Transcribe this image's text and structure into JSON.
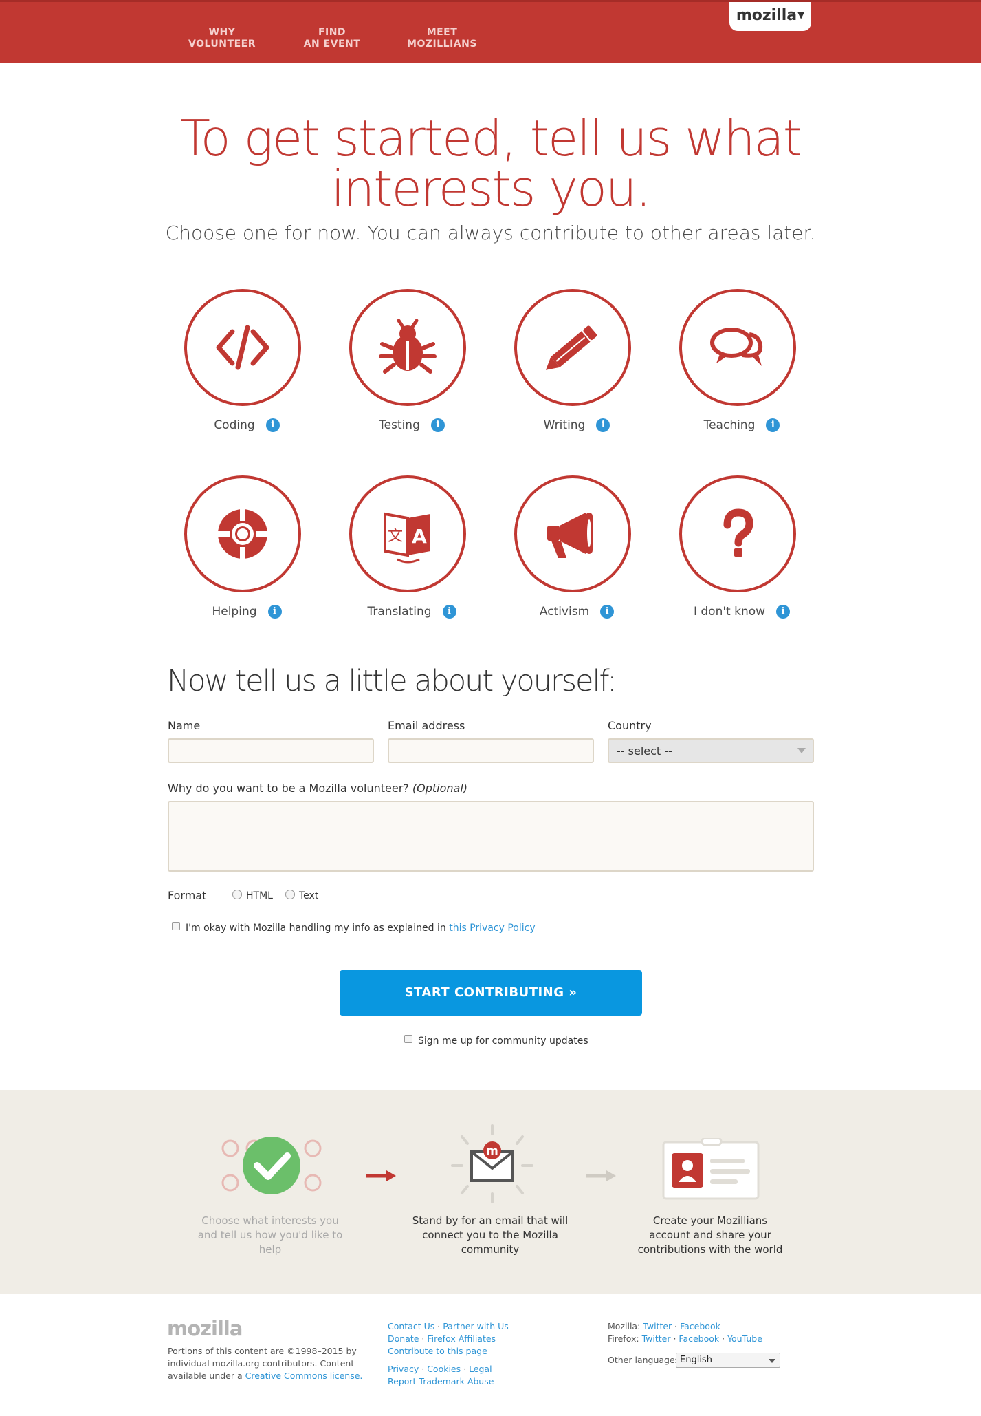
{
  "header": {
    "nav": [
      {
        "line1": "WHY",
        "line2": "VOLUNTEER"
      },
      {
        "line1": "FIND",
        "line2": "AN EVENT"
      },
      {
        "line1": "MEET",
        "line2": "MOZILLIANS"
      }
    ],
    "tab_label": "mozilla",
    "tab_icon": "chevron-down-icon"
  },
  "hero": {
    "title_line1": "To get started, tell us what",
    "title_line2": "interests you.",
    "subtitle": "Choose one for now. You can always contribute to other areas later."
  },
  "interests": [
    {
      "label": "Coding",
      "icon": "code-icon"
    },
    {
      "label": "Testing",
      "icon": "bug-icon"
    },
    {
      "label": "Writing",
      "icon": "pencil-icon"
    },
    {
      "label": "Teaching",
      "icon": "chat-bubbles-icon"
    },
    {
      "label": "Helping",
      "icon": "lifebuoy-icon"
    },
    {
      "label": "Translating",
      "icon": "translate-icon"
    },
    {
      "label": "Activism",
      "icon": "megaphone-icon"
    },
    {
      "label": "I don't know",
      "icon": "question-mark-icon"
    }
  ],
  "info_glyph": "i",
  "form": {
    "section_title": "Now tell us a little about yourself:",
    "name_label": "Name",
    "email_label": "Email address",
    "country_label": "Country",
    "country_value": "-- select --",
    "why_label": "Why do you want to be a Mozilla volunteer?",
    "why_optional": "(Optional)",
    "format_label": "Format",
    "format_html": "HTML",
    "format_text": "Text",
    "privacy_text": "I'm okay with Mozilla handling my info as explained in",
    "privacy_link": "this Privacy Policy",
    "submit": "START CONTRIBUTING »",
    "updates_label": "Sign me up for community updates"
  },
  "steps": [
    {
      "text": "Choose what interests you and tell us how you'd like to help",
      "icon": "checkmark-icon"
    },
    {
      "text": "Stand by for an email that will connect you to the Mozilla community",
      "icon": "mail-icon"
    },
    {
      "text": "Create your Mozillians account and share your contributions with the world",
      "icon": "id-card-icon"
    }
  ],
  "footer": {
    "logo": "mozilla",
    "copyright": "Portions of this content are ©1998–2015 by individual mozilla.org contributors. Content available under a",
    "cc_link": "Creative Commons license.",
    "links_col2": {
      "contact": "Contact Us",
      "partner": "Partner with Us",
      "donate": "Donate",
      "affiliates": "Firefox Affiliates",
      "contribute": "Contribute to this page",
      "privacy": "Privacy",
      "cookies": "Cookies",
      "legal": "Legal",
      "trademark": "Report Trademark Abuse"
    },
    "social": {
      "mozilla_label": "Mozilla:",
      "mozilla_twitter": "Twitter",
      "mozilla_facebook": "Facebook",
      "firefox_label": "Firefox:",
      "firefox_twitter": "Twitter",
      "firefox_facebook": "Facebook",
      "firefox_youtube": "YouTube"
    },
    "other_languages_label": "Other languages:",
    "language_value": "English"
  },
  "colors": {
    "brand_red": "#c13832",
    "cta_blue": "#0997e0",
    "info_blue": "#2f95d6",
    "band_bg": "#f0ede6",
    "success_green": "#6bbf6a"
  }
}
